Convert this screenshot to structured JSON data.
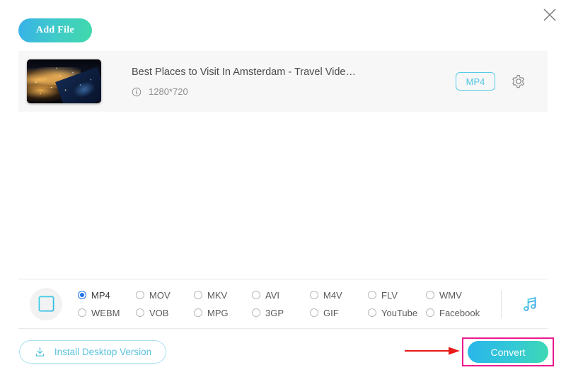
{
  "window": {
    "close_icon": "close-icon"
  },
  "toolbar": {
    "add_file_label": "Add File"
  },
  "file": {
    "title": "Best Places to Visit In Amsterdam - Travel Vide…",
    "resolution": "1280*720",
    "info_icon": "info-circle-icon",
    "output_format_badge": "MP4",
    "settings_icon": "gear-icon",
    "thumbnail_alt": "night-cityscape-thumbnail"
  },
  "format_panel": {
    "video_icon": "film-strip-icon",
    "audio_icon": "music-note-icon",
    "selected": "MP4",
    "options": [
      {
        "label": "MP4",
        "selected": true
      },
      {
        "label": "MOV",
        "selected": false
      },
      {
        "label": "MKV",
        "selected": false
      },
      {
        "label": "AVI",
        "selected": false
      },
      {
        "label": "M4V",
        "selected": false
      },
      {
        "label": "FLV",
        "selected": false
      },
      {
        "label": "WMV",
        "selected": false
      },
      {
        "label": "WEBM",
        "selected": false
      },
      {
        "label": "VOB",
        "selected": false
      },
      {
        "label": "MPG",
        "selected": false
      },
      {
        "label": "3GP",
        "selected": false
      },
      {
        "label": "GIF",
        "selected": false
      },
      {
        "label": "YouTube",
        "selected": false
      },
      {
        "label": "Facebook",
        "selected": false
      }
    ]
  },
  "footer": {
    "install_label": "Install Desktop Version",
    "install_icon": "download-icon",
    "convert_label": "Convert"
  },
  "annotations": {
    "highlight_color": "#ec1a8d",
    "arrow_color": "#e81a1a"
  },
  "colors": {
    "accent_cyan": "#4cc3e4",
    "gradient_start": "#29b6ea",
    "gradient_end": "#3ed9b2",
    "radio_selected": "#1a73e8",
    "row_background": "#f7f7f7"
  }
}
